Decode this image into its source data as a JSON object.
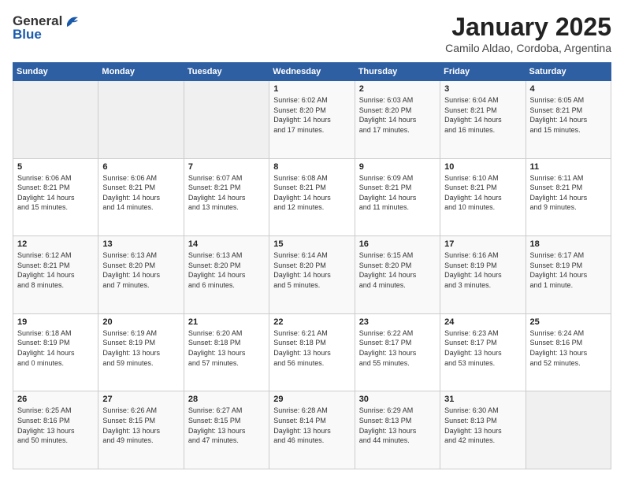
{
  "logo": {
    "general": "General",
    "blue": "Blue"
  },
  "title": "January 2025",
  "subtitle": "Camilo Aldao, Cordoba, Argentina",
  "weekdays": [
    "Sunday",
    "Monday",
    "Tuesday",
    "Wednesday",
    "Thursday",
    "Friday",
    "Saturday"
  ],
  "weeks": [
    [
      {
        "day": "",
        "info": ""
      },
      {
        "day": "",
        "info": ""
      },
      {
        "day": "",
        "info": ""
      },
      {
        "day": "1",
        "info": "Sunrise: 6:02 AM\nSunset: 8:20 PM\nDaylight: 14 hours\nand 17 minutes."
      },
      {
        "day": "2",
        "info": "Sunrise: 6:03 AM\nSunset: 8:20 PM\nDaylight: 14 hours\nand 17 minutes."
      },
      {
        "day": "3",
        "info": "Sunrise: 6:04 AM\nSunset: 8:21 PM\nDaylight: 14 hours\nand 16 minutes."
      },
      {
        "day": "4",
        "info": "Sunrise: 6:05 AM\nSunset: 8:21 PM\nDaylight: 14 hours\nand 15 minutes."
      }
    ],
    [
      {
        "day": "5",
        "info": "Sunrise: 6:06 AM\nSunset: 8:21 PM\nDaylight: 14 hours\nand 15 minutes."
      },
      {
        "day": "6",
        "info": "Sunrise: 6:06 AM\nSunset: 8:21 PM\nDaylight: 14 hours\nand 14 minutes."
      },
      {
        "day": "7",
        "info": "Sunrise: 6:07 AM\nSunset: 8:21 PM\nDaylight: 14 hours\nand 13 minutes."
      },
      {
        "day": "8",
        "info": "Sunrise: 6:08 AM\nSunset: 8:21 PM\nDaylight: 14 hours\nand 12 minutes."
      },
      {
        "day": "9",
        "info": "Sunrise: 6:09 AM\nSunset: 8:21 PM\nDaylight: 14 hours\nand 11 minutes."
      },
      {
        "day": "10",
        "info": "Sunrise: 6:10 AM\nSunset: 8:21 PM\nDaylight: 14 hours\nand 10 minutes."
      },
      {
        "day": "11",
        "info": "Sunrise: 6:11 AM\nSunset: 8:21 PM\nDaylight: 14 hours\nand 9 minutes."
      }
    ],
    [
      {
        "day": "12",
        "info": "Sunrise: 6:12 AM\nSunset: 8:21 PM\nDaylight: 14 hours\nand 8 minutes."
      },
      {
        "day": "13",
        "info": "Sunrise: 6:13 AM\nSunset: 8:20 PM\nDaylight: 14 hours\nand 7 minutes."
      },
      {
        "day": "14",
        "info": "Sunrise: 6:13 AM\nSunset: 8:20 PM\nDaylight: 14 hours\nand 6 minutes."
      },
      {
        "day": "15",
        "info": "Sunrise: 6:14 AM\nSunset: 8:20 PM\nDaylight: 14 hours\nand 5 minutes."
      },
      {
        "day": "16",
        "info": "Sunrise: 6:15 AM\nSunset: 8:20 PM\nDaylight: 14 hours\nand 4 minutes."
      },
      {
        "day": "17",
        "info": "Sunrise: 6:16 AM\nSunset: 8:19 PM\nDaylight: 14 hours\nand 3 minutes."
      },
      {
        "day": "18",
        "info": "Sunrise: 6:17 AM\nSunset: 8:19 PM\nDaylight: 14 hours\nand 1 minute."
      }
    ],
    [
      {
        "day": "19",
        "info": "Sunrise: 6:18 AM\nSunset: 8:19 PM\nDaylight: 14 hours\nand 0 minutes."
      },
      {
        "day": "20",
        "info": "Sunrise: 6:19 AM\nSunset: 8:19 PM\nDaylight: 13 hours\nand 59 minutes."
      },
      {
        "day": "21",
        "info": "Sunrise: 6:20 AM\nSunset: 8:18 PM\nDaylight: 13 hours\nand 57 minutes."
      },
      {
        "day": "22",
        "info": "Sunrise: 6:21 AM\nSunset: 8:18 PM\nDaylight: 13 hours\nand 56 minutes."
      },
      {
        "day": "23",
        "info": "Sunrise: 6:22 AM\nSunset: 8:17 PM\nDaylight: 13 hours\nand 55 minutes."
      },
      {
        "day": "24",
        "info": "Sunrise: 6:23 AM\nSunset: 8:17 PM\nDaylight: 13 hours\nand 53 minutes."
      },
      {
        "day": "25",
        "info": "Sunrise: 6:24 AM\nSunset: 8:16 PM\nDaylight: 13 hours\nand 52 minutes."
      }
    ],
    [
      {
        "day": "26",
        "info": "Sunrise: 6:25 AM\nSunset: 8:16 PM\nDaylight: 13 hours\nand 50 minutes."
      },
      {
        "day": "27",
        "info": "Sunrise: 6:26 AM\nSunset: 8:15 PM\nDaylight: 13 hours\nand 49 minutes."
      },
      {
        "day": "28",
        "info": "Sunrise: 6:27 AM\nSunset: 8:15 PM\nDaylight: 13 hours\nand 47 minutes."
      },
      {
        "day": "29",
        "info": "Sunrise: 6:28 AM\nSunset: 8:14 PM\nDaylight: 13 hours\nand 46 minutes."
      },
      {
        "day": "30",
        "info": "Sunrise: 6:29 AM\nSunset: 8:13 PM\nDaylight: 13 hours\nand 44 minutes."
      },
      {
        "day": "31",
        "info": "Sunrise: 6:30 AM\nSunset: 8:13 PM\nDaylight: 13 hours\nand 42 minutes."
      },
      {
        "day": "",
        "info": ""
      }
    ]
  ]
}
